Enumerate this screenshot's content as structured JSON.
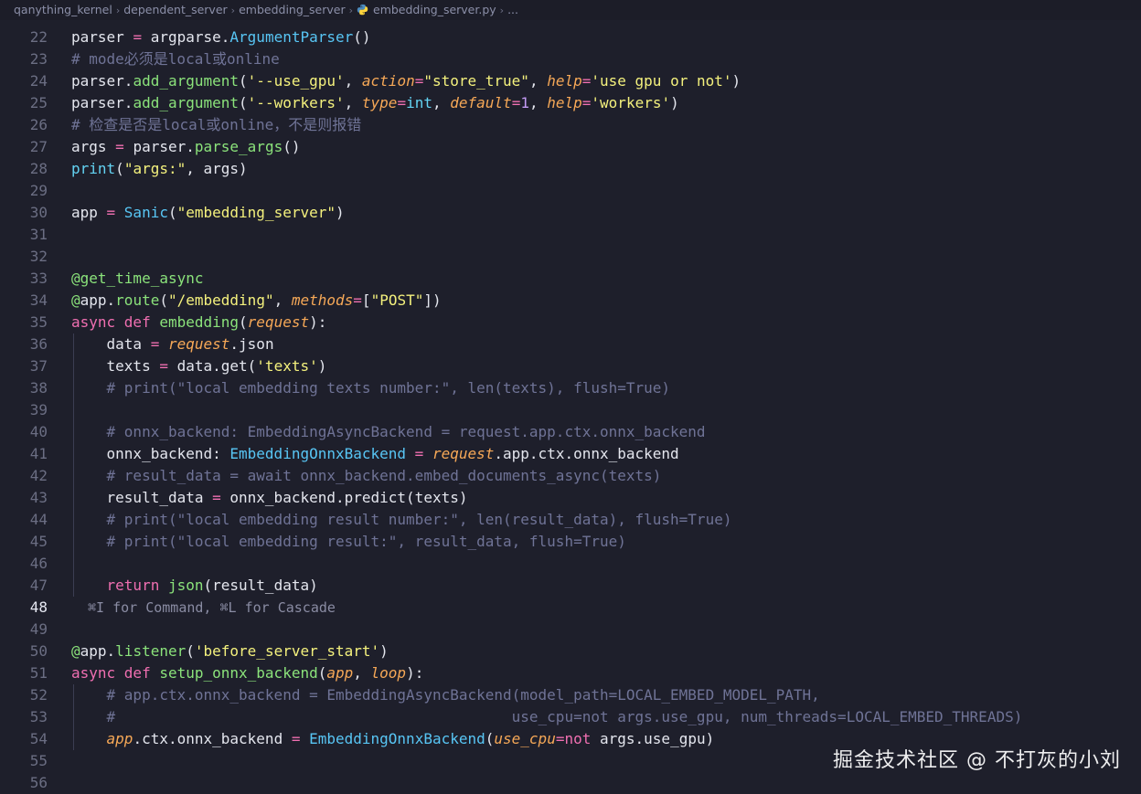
{
  "breadcrumb": {
    "items": [
      "qanything_kernel",
      "dependent_server",
      "embedding_server",
      "embedding_server.py",
      "..."
    ]
  },
  "editor": {
    "active_line": 48,
    "inline_hint": "⌘I for Command, ⌘L for Cascade",
    "lines": [
      {
        "n": "22",
        "tokens": [
          [
            "pu",
            "parser "
          ],
          [
            "kw",
            "= "
          ],
          [
            "pu",
            "argparse."
          ],
          [
            "cl",
            "ArgumentParser"
          ],
          [
            "pu",
            "()"
          ]
        ]
      },
      {
        "n": "23",
        "tokens": [
          [
            "cm",
            "# mode必须是local或online"
          ]
        ]
      },
      {
        "n": "24",
        "tokens": [
          [
            "pu",
            "parser."
          ],
          [
            "fn",
            "add_argument"
          ],
          [
            "pu",
            "("
          ],
          [
            "st",
            "'--use_gpu'"
          ],
          [
            "pu",
            ", "
          ],
          [
            "pr",
            "action"
          ],
          [
            "kw",
            "="
          ],
          [
            "st",
            "\"store_true\""
          ],
          [
            "pu",
            ", "
          ],
          [
            "pr",
            "help"
          ],
          [
            "kw",
            "="
          ],
          [
            "st",
            "'use gpu or not'"
          ],
          [
            "pu",
            ")"
          ]
        ]
      },
      {
        "n": "25",
        "tokens": [
          [
            "pu",
            "parser."
          ],
          [
            "fn",
            "add_argument"
          ],
          [
            "pu",
            "("
          ],
          [
            "st",
            "'--workers'"
          ],
          [
            "pu",
            ", "
          ],
          [
            "pr",
            "type"
          ],
          [
            "kw",
            "="
          ],
          [
            "bi",
            "int"
          ],
          [
            "pu",
            ", "
          ],
          [
            "pr",
            "default"
          ],
          [
            "kw",
            "="
          ],
          [
            "nu",
            "1"
          ],
          [
            "pu",
            ", "
          ],
          [
            "pr",
            "help"
          ],
          [
            "kw",
            "="
          ],
          [
            "st",
            "'workers'"
          ],
          [
            "pu",
            ")"
          ]
        ]
      },
      {
        "n": "26",
        "tokens": [
          [
            "cm",
            "# 检查是否是local或online，不是则报错"
          ]
        ]
      },
      {
        "n": "27",
        "tokens": [
          [
            "pu",
            "args "
          ],
          [
            "kw",
            "= "
          ],
          [
            "pu",
            "parser."
          ],
          [
            "fn",
            "parse_args"
          ],
          [
            "pu",
            "()"
          ]
        ]
      },
      {
        "n": "28",
        "tokens": [
          [
            "bi",
            "print"
          ],
          [
            "pu",
            "("
          ],
          [
            "st",
            "\"args:\""
          ],
          [
            "pu",
            ", args)"
          ]
        ]
      },
      {
        "n": "29",
        "tokens": []
      },
      {
        "n": "30",
        "tokens": [
          [
            "pu",
            "app "
          ],
          [
            "kw",
            "= "
          ],
          [
            "cl",
            "Sanic"
          ],
          [
            "pu",
            "("
          ],
          [
            "st",
            "\"embedding_server\""
          ],
          [
            "pu",
            ")"
          ]
        ]
      },
      {
        "n": "31",
        "tokens": []
      },
      {
        "n": "32",
        "tokens": []
      },
      {
        "n": "33",
        "tokens": [
          [
            "fn",
            "@get_time_async"
          ]
        ]
      },
      {
        "n": "34",
        "tokens": [
          [
            "fn",
            "@"
          ],
          [
            "pu",
            "app."
          ],
          [
            "fn",
            "route"
          ],
          [
            "pu",
            "("
          ],
          [
            "st",
            "\"/embedding\""
          ],
          [
            "pu",
            ", "
          ],
          [
            "pr",
            "methods"
          ],
          [
            "kw",
            "="
          ],
          [
            "pu",
            "["
          ],
          [
            "st",
            "\"POST\""
          ],
          [
            "pu",
            "])"
          ]
        ]
      },
      {
        "n": "35",
        "tokens": [
          [
            "kw",
            "async def "
          ],
          [
            "fn",
            "embedding"
          ],
          [
            "pu",
            "("
          ],
          [
            "pr",
            "request"
          ],
          [
            "pu",
            "):"
          ]
        ]
      },
      {
        "n": "36",
        "tokens": [
          [
            "pu",
            "    data "
          ],
          [
            "kw",
            "= "
          ],
          [
            "pr",
            "request"
          ],
          [
            "pu",
            ".json"
          ]
        ]
      },
      {
        "n": "37",
        "tokens": [
          [
            "pu",
            "    texts "
          ],
          [
            "kw",
            "= "
          ],
          [
            "pu",
            "data.get("
          ],
          [
            "st",
            "'texts'"
          ],
          [
            "pu",
            ")"
          ]
        ]
      },
      {
        "n": "38",
        "tokens": [
          [
            "pu",
            "    "
          ],
          [
            "cm",
            "# print(\"local embedding texts number:\", len(texts), flush=True)"
          ]
        ]
      },
      {
        "n": "39",
        "tokens": []
      },
      {
        "n": "40",
        "tokens": [
          [
            "pu",
            "    "
          ],
          [
            "cm",
            "# onnx_backend: EmbeddingAsyncBackend = request.app.ctx.onnx_backend"
          ]
        ]
      },
      {
        "n": "41",
        "tokens": [
          [
            "pu",
            "    onnx_backend: "
          ],
          [
            "cl",
            "EmbeddingOnnxBackend"
          ],
          [
            "kw",
            " = "
          ],
          [
            "pr",
            "request"
          ],
          [
            "pu",
            ".app.ctx.onnx_backend"
          ]
        ]
      },
      {
        "n": "42",
        "tokens": [
          [
            "pu",
            "    "
          ],
          [
            "cm",
            "# result_data = await onnx_backend.embed_documents_async(texts)"
          ]
        ]
      },
      {
        "n": "43",
        "tokens": [
          [
            "pu",
            "    result_data "
          ],
          [
            "kw",
            "= "
          ],
          [
            "pu",
            "onnx_backend.predict(texts)"
          ]
        ]
      },
      {
        "n": "44",
        "tokens": [
          [
            "pu",
            "    "
          ],
          [
            "cm",
            "# print(\"local embedding result number:\", len(result_data), flush=True)"
          ]
        ]
      },
      {
        "n": "45",
        "tokens": [
          [
            "pu",
            "    "
          ],
          [
            "cm",
            "# print(\"local embedding result:\", result_data, flush=True)"
          ]
        ]
      },
      {
        "n": "46",
        "tokens": []
      },
      {
        "n": "47",
        "tokens": [
          [
            "pu",
            "    "
          ],
          [
            "kw",
            "return "
          ],
          [
            "fn",
            "json"
          ],
          [
            "pu",
            "(result_data)"
          ]
        ]
      },
      {
        "n": "48",
        "hint": true
      },
      {
        "n": "49",
        "tokens": []
      },
      {
        "n": "50",
        "tokens": [
          [
            "fn",
            "@"
          ],
          [
            "pu",
            "app."
          ],
          [
            "fn",
            "listener"
          ],
          [
            "pu",
            "("
          ],
          [
            "st",
            "'before_server_start'"
          ],
          [
            "pu",
            ")"
          ]
        ]
      },
      {
        "n": "51",
        "tokens": [
          [
            "kw",
            "async def "
          ],
          [
            "fn",
            "setup_onnx_backend"
          ],
          [
            "pu",
            "("
          ],
          [
            "pr",
            "app"
          ],
          [
            "pu",
            ", "
          ],
          [
            "pr",
            "loop"
          ],
          [
            "pu",
            "):"
          ]
        ]
      },
      {
        "n": "52",
        "tokens": [
          [
            "pu",
            "    "
          ],
          [
            "cm",
            "# app.ctx.onnx_backend = EmbeddingAsyncBackend(model_path=LOCAL_EMBED_MODEL_PATH,"
          ]
        ]
      },
      {
        "n": "53",
        "tokens": [
          [
            "pu",
            "    "
          ],
          [
            "cm",
            "#                                             use_cpu=not args.use_gpu, num_threads=LOCAL_EMBED_THREADS)"
          ]
        ]
      },
      {
        "n": "54",
        "tokens": [
          [
            "pu",
            "    "
          ],
          [
            "pr",
            "app"
          ],
          [
            "pu",
            ".ctx.onnx_backend "
          ],
          [
            "kw",
            "= "
          ],
          [
            "cl",
            "EmbeddingOnnxBackend"
          ],
          [
            "pu",
            "("
          ],
          [
            "pr",
            "use_cpu"
          ],
          [
            "kw",
            "=not "
          ],
          [
            "pu",
            "args.use_gpu)"
          ]
        ]
      },
      {
        "n": "55",
        "tokens": []
      },
      {
        "n": "56",
        "tokens": []
      }
    ]
  },
  "watermark": "掘金技术社区 @ 不打灰的小刘",
  "colors": {
    "background": "#1e1f2b",
    "keyword": "#f06fb1",
    "function": "#8be37b",
    "class": "#58c6f5",
    "string": "#f4f17d",
    "comment": "#6f7396",
    "parameter": "#f6a857",
    "number": "#c49bf5"
  },
  "icons": [
    "chevron-right-icon",
    "python-file-icon"
  ]
}
